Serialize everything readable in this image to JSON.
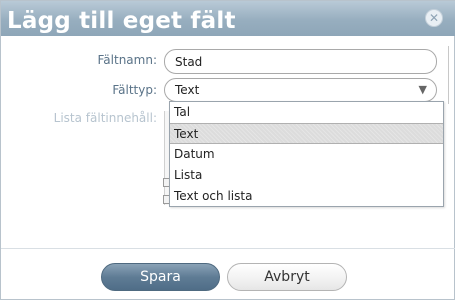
{
  "dialog": {
    "title": "Lägg till eget fält",
    "close_icon": "close-circle-icon"
  },
  "form": {
    "name_label": "Fältnamn:",
    "name_value": "Stad",
    "type_label": "Fälttyp:",
    "type_value": "Text",
    "list_label": "Lista fältinnehåll:"
  },
  "dropdown": {
    "options": [
      "Tal",
      "Text",
      "Datum",
      "Lista",
      "Text och lista"
    ],
    "selected": "Text"
  },
  "buttons": {
    "save": "Spara",
    "cancel": "Avbryt"
  },
  "colors": {
    "titlebar": "#97aebf",
    "label_text": "#5a7388",
    "primary_button": "#5f7c95"
  }
}
